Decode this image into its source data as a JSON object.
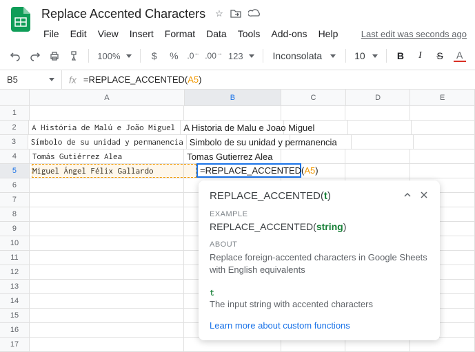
{
  "doc": {
    "title": "Replace Accented Characters"
  },
  "menus": {
    "file": "File",
    "edit": "Edit",
    "view": "View",
    "insert": "Insert",
    "format": "Format",
    "data": "Data",
    "tools": "Tools",
    "addons": "Add-ons",
    "help": "Help",
    "last_edit": "Last edit was seconds ago"
  },
  "toolbar": {
    "zoom": "100%",
    "currency": "$",
    "percent": "%",
    "dec_dec": ".0",
    "inc_dec": ".00",
    "more_fmt": "123",
    "font": "Inconsolata",
    "font_size": "10",
    "bold": "B",
    "italic": "I",
    "strike": "S",
    "color": "A"
  },
  "formula_bar": {
    "cell_ref": "B5",
    "fx": "fx",
    "formula_prefix": "=REPLACE_ACCENTED(",
    "formula_arg": "A5",
    "formula_suffix": ")"
  },
  "columns": [
    "A",
    "B",
    "C",
    "D",
    "E"
  ],
  "row_numbers": [
    "1",
    "2",
    "3",
    "4",
    "5",
    "6",
    "7",
    "8",
    "9",
    "10",
    "11",
    "12",
    "13",
    "14",
    "15",
    "16",
    "17"
  ],
  "cells": {
    "A2": "A História de Malú e João Miguel",
    "B2": "A Historia de Malu e Joao Miguel",
    "A3": "Símbolo de su unidad y permanencia",
    "B3": "Simbolo de su unidad y permanencia",
    "A4": "Tomás Gutiérrez Alea",
    "B4": "Tomas Gutierrez Alea",
    "A5": "Miguel Ángel Félix Gallardo",
    "B5_prefix": "=REPLACE_ACCENTED(",
    "B5_arg": "A5",
    "B5_suffix": ")"
  },
  "tooltip": {
    "sig_name": "REPLACE_ACCENTED(",
    "sig_arg": "t",
    "sig_close": ")",
    "example_label": "EXAMPLE",
    "example_name": "REPLACE_ACCENTED(",
    "example_arg": "string",
    "example_close": ")",
    "about_label": "ABOUT",
    "about_text": "Replace foreign-accented characters in Google Sheets with English equivalents",
    "param": "t",
    "param_desc": "The input string with accented characters",
    "link": "Learn more about custom functions"
  }
}
